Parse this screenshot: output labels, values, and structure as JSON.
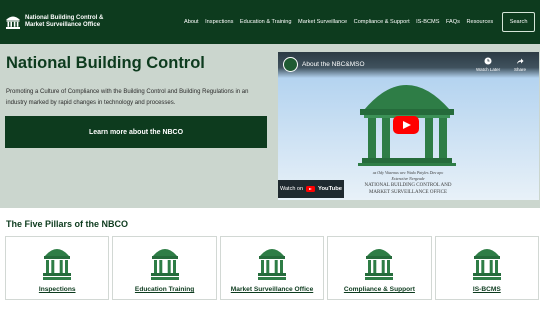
{
  "header": {
    "brand_name": "National Building Control & Market Surveillance Office",
    "nav_items": [
      "About",
      "Inspections",
      "Education & Training",
      "Market Surveillance",
      "Compliance & Support",
      "IS-BCMS",
      "FAQs",
      "Resources"
    ],
    "search_label": "Search"
  },
  "hero": {
    "title": "National Building Control",
    "description": "Promoting a Culture of Compliance with the Building Control and Building Regulations in an industry marked by rapid changes in technology and processes.",
    "cta_label": "Learn more about the NBCO"
  },
  "video": {
    "title": "About the NBC&MSO",
    "watch_later": "Watch Later",
    "share": "Share",
    "caption_line1": "as Ody Vitaenus wec Wado Patyles Dav apo",
    "caption_line2": "Extenctive Nergeade",
    "caption_line3": "NATIONAL BUILDING CONTROL AND",
    "caption_line4": "MARKET SURVEILLANCE OFFICE",
    "watch_on": "Watch on",
    "youtube": "YouTube"
  },
  "pillars": {
    "title": "The Five Pillars of the NBCO",
    "items": [
      {
        "label": "Inspections"
      },
      {
        "label": "Education Training"
      },
      {
        "label": "Market Surveillance Office"
      },
      {
        "label": "Compliance & Support"
      },
      {
        "label": "IS-BCMS"
      }
    ]
  },
  "colors": {
    "brand_dark_green": "#0d3b1e",
    "hero_background": "#cbd6ce",
    "icon_green": "#2e7d46",
    "youtube_red": "#ff0000"
  },
  "icons": [
    "building-logo-icon",
    "play-icon",
    "clock-icon",
    "share-icon",
    "youtube-icon",
    "pillar-building-icon"
  ]
}
